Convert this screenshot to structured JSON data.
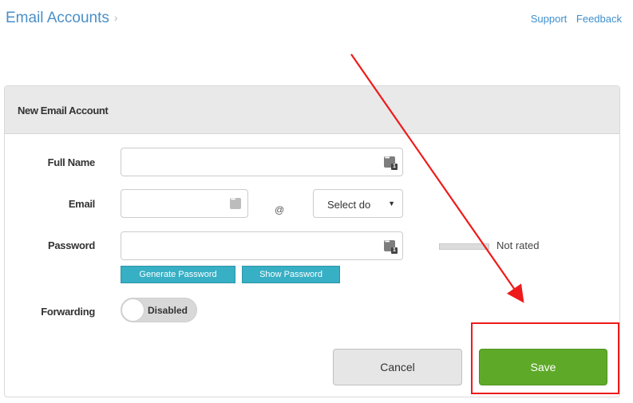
{
  "header": {
    "breadcrumb_title": "Email Accounts",
    "breadcrumb_separator": "›",
    "links": {
      "support": "Support",
      "feedback": "Feedback"
    }
  },
  "panel": {
    "title": "New Email Account",
    "fields": {
      "full_name": {
        "label": "Full Name",
        "value": ""
      },
      "email": {
        "label": "Email",
        "value": "",
        "at_symbol": "@",
        "domain_select": "Select do"
      },
      "password": {
        "label": "Password",
        "value": "",
        "strength_text": "Not rated",
        "strength_level": 0,
        "generate_button": "Generate Password",
        "show_button": "Show Password"
      },
      "forwarding": {
        "label": "Forwarding",
        "toggle_text": "Disabled",
        "enabled": false
      }
    },
    "buttons": {
      "cancel": "Cancel",
      "save": "Save"
    }
  },
  "annotation": {
    "color": "#ef1a1a"
  },
  "colors": {
    "link": "#3f8fce",
    "save_button": "#5ea928",
    "password_buttons": "#37afc4",
    "header_bg": "#e9e9e9"
  },
  "icons": {
    "field_icon": "keyboard-icon",
    "select_caret": "caret-down-icon"
  },
  "key_badge": "1"
}
